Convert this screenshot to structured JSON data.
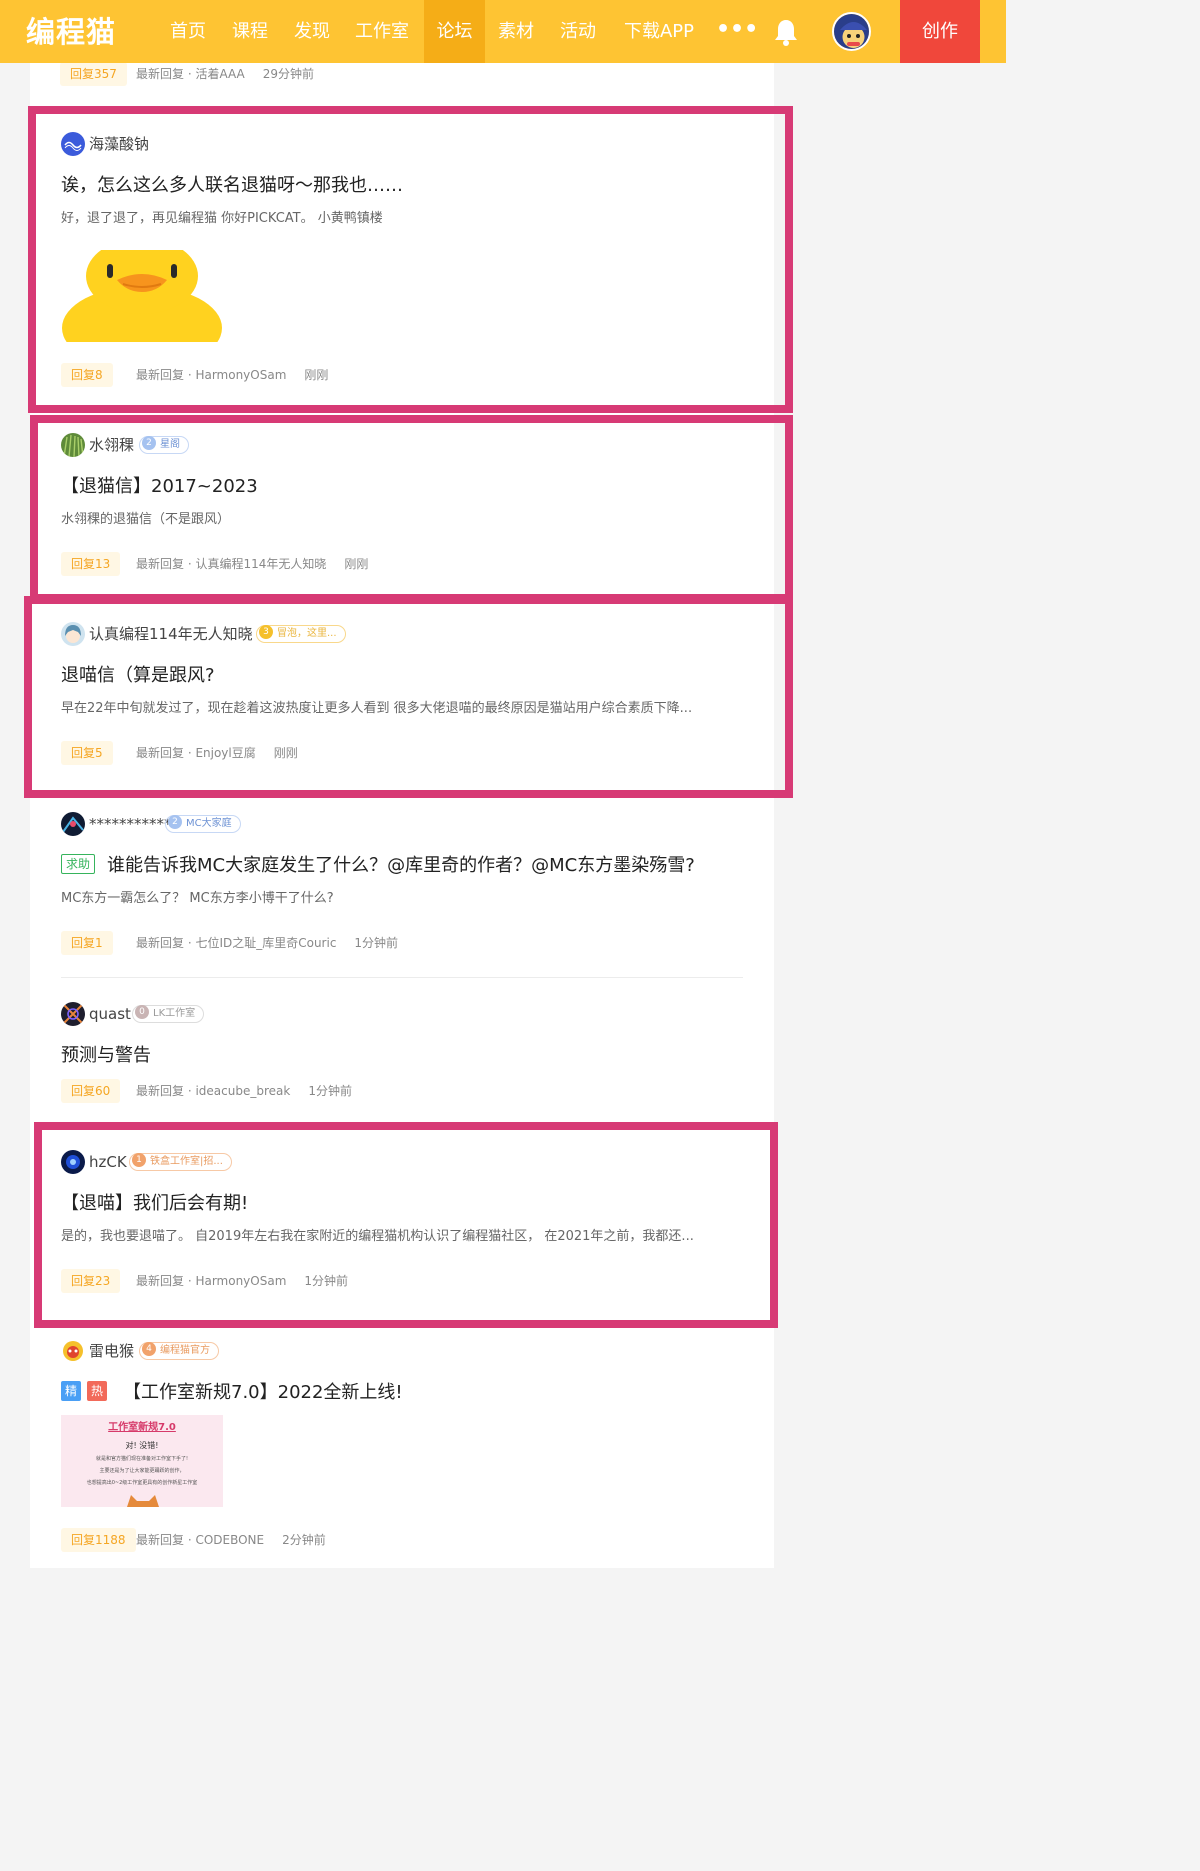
{
  "nav": {
    "logo": "编程猫",
    "items": [
      {
        "label": "首页",
        "active": false
      },
      {
        "label": "课程",
        "active": false
      },
      {
        "label": "发现",
        "active": false
      },
      {
        "label": "工作室",
        "active": false
      },
      {
        "label": "论坛",
        "active": true
      },
      {
        "label": "素材",
        "active": false
      },
      {
        "label": "活动",
        "active": false
      },
      {
        "label": "下载APP",
        "active": false
      }
    ],
    "more": "•••",
    "create": "创作"
  },
  "posts": [
    {
      "reply": "回复357",
      "latest": "最新回复 · 活着AAA",
      "time": "29分钟前"
    },
    {
      "author": "海藻酸钠",
      "title": "诶，怎么这么多人联名退猫呀～那我也……",
      "excerpt": "好，退了退了，再见编程猫   你好PICKCAT。   小黄鸭镇楼",
      "reply": "回复8",
      "latest": "最新回复 · HarmonyOSam",
      "time": "刚刚"
    },
    {
      "author": "水翎稞",
      "badge_level": "2",
      "badge_text": "星阁",
      "title": "【退猫信】2017~2023",
      "excerpt": "水翎稞的退猫信（不是跟风）",
      "reply": "回复13",
      "latest": "最新回复 · 认真编程114年无人知晓",
      "time": "刚刚"
    },
    {
      "author": "认真编程114年无人知晓",
      "badge_level": "3",
      "badge_text": "冒泡，这里...",
      "title": "退喵信（算是跟风?",
      "excerpt": "早在22年中旬就发过了，现在趁着这波热度让更多人看到 很多大佬退喵的最终原因是猫站用户综合素质下降...",
      "reply": "回复5",
      "latest": "最新回复 · Enjoyl豆腐",
      "time": "刚刚"
    },
    {
      "author": "***********",
      "badge_level": "2",
      "badge_text": "MC大家庭",
      "tag": "求助",
      "title": "谁能告诉我MC大家庭发生了什么？@库里奇的作者？@MC东方墨染殇雪?",
      "excerpt": "MC东方一霸怎么了？ MC东方李小博干了什么?",
      "reply": "回复1",
      "latest": "最新回复 · 七位ID之耻_库里奇Couric",
      "time": "1分钟前"
    },
    {
      "author": "quast",
      "badge_level": "0",
      "badge_text": "LK工作室",
      "title": "预测与警告",
      "reply": "回复60",
      "latest": "最新回复 · ideacube_break",
      "time": "1分钟前"
    },
    {
      "author": "hzCK",
      "badge_level": "1",
      "badge_text": "铁盒工作室|招...",
      "title": "【退喵】我们后会有期!",
      "excerpt": "是的，我也要退喵了。 自2019年左右我在家附近的编程猫机构认识了编程猫社区， 在2021年之前，我都还...",
      "reply": "回复23",
      "latest": "最新回复 · HarmonyOSam",
      "time": "1分钟前"
    },
    {
      "author": "雷电猴",
      "badge_level": "4",
      "badge_text": "编程猫官方",
      "tag_jing": "精",
      "tag_re": "热",
      "title": "【工作室新规7.0】2022全新上线!",
      "thumb_title": "工作室新规7.0",
      "thumb_lines": [
        "对! 没错!",
        "就是和官方猫们现在准备对工作室下手了!",
        "主要还是为了让大家能更踊跃的创作，",
        "也想提高出0~2级工作室更具有的创作新星工作室"
      ],
      "reply": "回复1188",
      "latest": "最新回复 · CODEBONE",
      "time": "2分钟前"
    }
  ],
  "colors": {
    "nav_bg": "#fec433",
    "nav_active": "#f5ad17",
    "create_bg": "#f0473b",
    "highlight": "#d73a75",
    "reply_text": "#f5a623"
  }
}
